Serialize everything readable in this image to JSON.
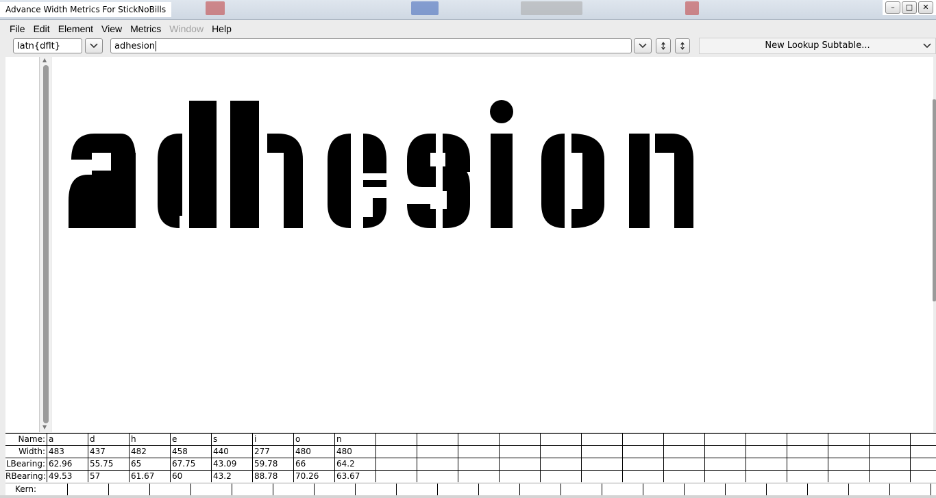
{
  "window": {
    "title": "Advance Width Metrics For StickNoBills",
    "controls": {
      "minimize": "–",
      "maximize": "□",
      "close": "✕"
    }
  },
  "menu": [
    {
      "label": "File",
      "enabled": true
    },
    {
      "label": "Edit",
      "enabled": true
    },
    {
      "label": "Element",
      "enabled": true
    },
    {
      "label": "View",
      "enabled": true
    },
    {
      "label": "Metrics",
      "enabled": true
    },
    {
      "label": "Window",
      "enabled": false
    },
    {
      "label": "Help",
      "enabled": true
    }
  ],
  "toolbar": {
    "script_value": "latn{dflt}",
    "text_value": "adhesion",
    "lookup_subtable": "New Lookup Subtable...",
    "icons": [
      "chevron-down-icon",
      "chevron-down-icon",
      "up-down-arrow-icon",
      "up-down-arrow-icon"
    ]
  },
  "preview": {
    "text": "adhesion",
    "color": "#000000"
  },
  "metrics": {
    "row_labels": {
      "name": "Name:",
      "width": "Width:",
      "lbearing": "LBearing:",
      "rbearing": "RBearing:",
      "kern": "Kern:"
    },
    "glyphs": [
      {
        "name": "a",
        "width": "483",
        "lbearing": "62.96",
        "rbearing": "49.53"
      },
      {
        "name": "d",
        "width": "437",
        "lbearing": "55.75",
        "rbearing": "57"
      },
      {
        "name": "h",
        "width": "482",
        "lbearing": "65",
        "rbearing": "61.67"
      },
      {
        "name": "e",
        "width": "458",
        "lbearing": "67.75",
        "rbearing": "60"
      },
      {
        "name": "s",
        "width": "440",
        "lbearing": "43.09",
        "rbearing": "43.2"
      },
      {
        "name": "i",
        "width": "277",
        "lbearing": "59.78",
        "rbearing": "88.78"
      },
      {
        "name": "o",
        "width": "480",
        "lbearing": "66",
        "rbearing": "70.26"
      },
      {
        "name": "n",
        "width": "480",
        "lbearing": "64.2",
        "rbearing": "63.67"
      }
    ]
  }
}
